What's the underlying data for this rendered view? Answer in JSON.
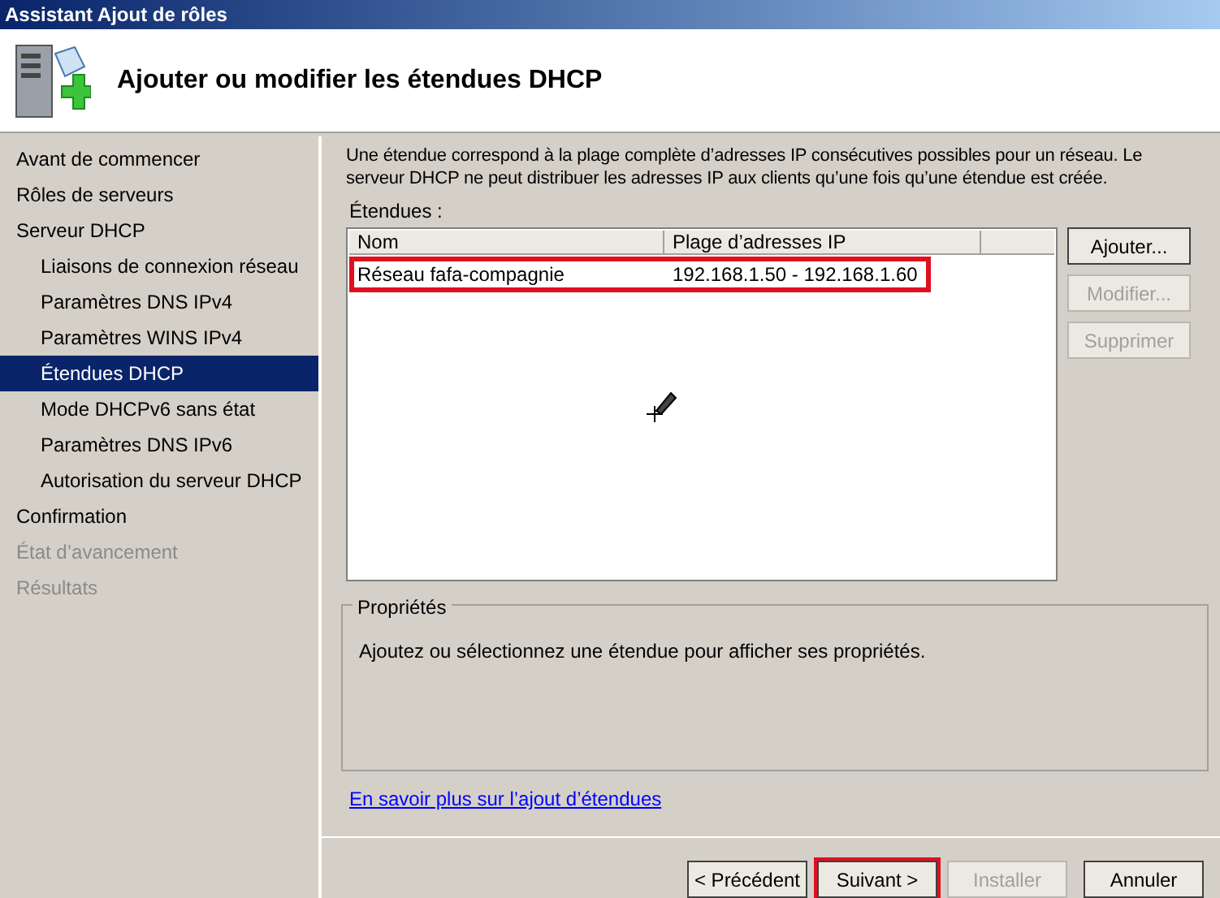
{
  "window": {
    "title": "Assistant Ajout de rôles"
  },
  "header": {
    "title": "Ajouter ou modifier les étendues DHCP"
  },
  "sidebar": {
    "items": [
      {
        "label": "Avant de commencer",
        "selected": false,
        "disabled": false
      },
      {
        "label": "Rôles de serveurs",
        "selected": false,
        "disabled": false
      },
      {
        "label": "Serveur DHCP",
        "selected": false,
        "disabled": false,
        "children": [
          {
            "label": "Liaisons de connexion réseau",
            "selected": false,
            "disabled": false
          },
          {
            "label": "Paramètres DNS IPv4",
            "selected": false,
            "disabled": false
          },
          {
            "label": "Paramètres WINS IPv4",
            "selected": false,
            "disabled": false
          },
          {
            "label": "Étendues DHCP",
            "selected": true,
            "disabled": false
          },
          {
            "label": "Mode DHCPv6 sans état",
            "selected": false,
            "disabled": false
          },
          {
            "label": "Paramètres DNS IPv6",
            "selected": false,
            "disabled": false
          },
          {
            "label": "Autorisation du serveur DHCP",
            "selected": false,
            "disabled": false
          }
        ]
      },
      {
        "label": "Confirmation",
        "selected": false,
        "disabled": false
      },
      {
        "label": "État d’avancement",
        "selected": false,
        "disabled": true
      },
      {
        "label": "Résultats",
        "selected": false,
        "disabled": true
      }
    ]
  },
  "description": "Une étendue correspond à la plage complète d’adresses IP consécutives possibles pour un réseau. Le serveur DHCP ne peut distribuer les adresses IP aux clients qu’une fois qu’une étendue est créée.",
  "scopes": {
    "label": "Étendues :",
    "columns": [
      "Nom",
      "Plage d’adresses IP"
    ],
    "rows": [
      {
        "cells": [
          "Réseau fafa-compagnie",
          "192.168.1.50 - 192.168.1.60"
        ],
        "highlighted": true
      }
    ]
  },
  "side_buttons": [
    {
      "label": "Ajouter...",
      "disabled": false
    },
    {
      "label": "Modifier...",
      "disabled": true
    },
    {
      "label": "Supprimer",
      "disabled": true
    }
  ],
  "properties": {
    "title": "Propriétés",
    "text": "Ajoutez ou sélectionnez une étendue pour afficher ses propriétés."
  },
  "link": "En savoir plus sur l’ajout d’étendues",
  "footer_buttons": [
    {
      "label": "< Précédent",
      "disabled": false,
      "highlighted": false
    },
    {
      "label": "Suivant >",
      "disabled": false,
      "highlighted": true
    },
    {
      "label": "Installer",
      "disabled": true,
      "highlighted": false
    },
    {
      "label": "Annuler",
      "disabled": false,
      "highlighted": false
    }
  ]
}
